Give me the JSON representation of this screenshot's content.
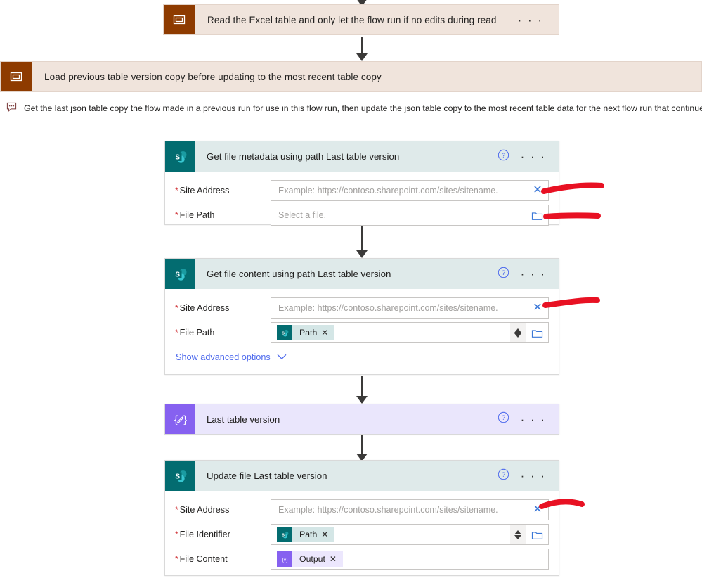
{
  "top_scope": {
    "title": "Read the Excel table and only let the flow run if no edits during read",
    "icon": "scope-icon",
    "ellipsis": "· · ·",
    "bar_color": "#f0e4dc",
    "icon_color": "#8e3b00"
  },
  "scope": {
    "title": "Load previous table version copy before updating to the most recent table copy",
    "icon": "scope-icon",
    "description": "Get the last json table copy the flow made in a previous run for use in this flow run, then update the json table copy to the most recent table data for the next flow run that continues to this step.",
    "description_icon": "comment-bubble-icon"
  },
  "common": {
    "help_icon": "help-circle-icon",
    "ellipsis": "· · ·",
    "clear_icon": "✕",
    "folder_icon": "folder-icon",
    "required_marker": "*",
    "sharepoint_icon": "sharepoint-icon",
    "compose_icon": "compose-icon",
    "site_address_placeholder": "Example: https://contoso.sharepoint.com/sites/sitename.",
    "accent_blue": "#4f6bed",
    "required_red": "#d13438",
    "ink_red": "#e81123"
  },
  "cards": [
    {
      "id": "get-file-metadata",
      "title": "Get file metadata using path Last table version",
      "app": "sharepoint",
      "fields": [
        {
          "label": "Site Address",
          "required": true,
          "placeholder": "Example: https://contoso.sharepoint.com/sites/sitename.",
          "value": "",
          "trailing": "clear"
        },
        {
          "label": "File Path",
          "required": true,
          "placeholder": "Select a file.",
          "value": "",
          "trailing": "folder"
        }
      ]
    },
    {
      "id": "get-file-content",
      "title": "Get file content using path Last table version",
      "app": "sharepoint",
      "fields": [
        {
          "label": "Site Address",
          "required": true,
          "placeholder": "Example: https://contoso.sharepoint.com/sites/sitename.",
          "value": "",
          "trailing": "clear"
        },
        {
          "label": "File Path",
          "required": true,
          "placeholder": "",
          "token": {
            "label": "Path",
            "icon": "sharepoint-icon",
            "remove": "✕",
            "style": "teal"
          },
          "trailing": "spinner-folder"
        }
      ],
      "advanced_options_label": "Show advanced options"
    },
    {
      "id": "last-table-version",
      "title": "Last table version",
      "app": "compose",
      "fields": []
    },
    {
      "id": "update-file",
      "title": "Update file Last table version",
      "app": "sharepoint",
      "fields": [
        {
          "label": "Site Address",
          "required": true,
          "placeholder": "Example: https://contoso.sharepoint.com/sites/sitename.",
          "value": "",
          "trailing": "clear"
        },
        {
          "label": "File Identifier",
          "required": true,
          "placeholder": "",
          "token": {
            "label": "Path",
            "icon": "sharepoint-icon",
            "remove": "✕",
            "style": "teal"
          },
          "trailing": "spinner-folder"
        },
        {
          "label": "File Content",
          "required": true,
          "placeholder": "",
          "token": {
            "label": "Output",
            "icon": "compose-icon",
            "remove": "✕",
            "style": "purple"
          },
          "trailing": "none"
        }
      ]
    }
  ],
  "annotations": [
    {
      "name": "ink-stroke-site-address-1"
    },
    {
      "name": "ink-stroke-file-path-1"
    },
    {
      "name": "ink-stroke-site-address-2"
    },
    {
      "name": "ink-stroke-site-address-3"
    }
  ]
}
